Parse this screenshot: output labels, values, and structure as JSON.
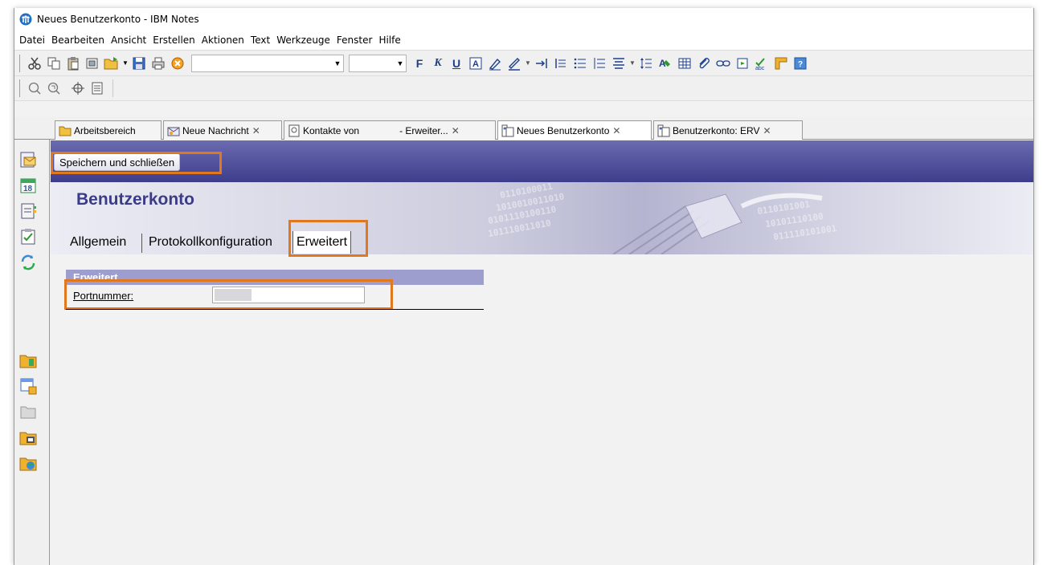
{
  "window": {
    "title": "Neues Benutzerkonto - IBM Notes"
  },
  "menu": [
    "Datei",
    "Bearbeiten",
    "Ansicht",
    "Erstellen",
    "Aktionen",
    "Text",
    "Werkzeuge",
    "Fenster",
    "Hilfe"
  ],
  "toolbar": {
    "icons": [
      "cut-icon",
      "copy-icon",
      "paste-icon",
      "paste-special-icon",
      "open-folder-icon",
      "save-icon",
      "print-icon",
      "stop-icon"
    ],
    "format_buttons": [
      "F",
      "K",
      "U"
    ],
    "format_icons": [
      "text-color-icon",
      "highlighter-icon",
      "pen-color-icon",
      "indent-icon",
      "outdent-icon",
      "bullet-list-icon",
      "numbered-list-icon",
      "align-icon",
      "spacing-icon",
      "styles-icon",
      "table-icon",
      "attachment-icon",
      "link-icon",
      "insert-icon",
      "spellcheck-icon",
      "hotspot-icon",
      "properties-icon"
    ]
  },
  "toolbar2": {
    "icons": [
      "search-icon",
      "search-next-icon",
      "navigate-icon",
      "calendar-view-icon"
    ]
  },
  "tabs": [
    {
      "label": "Arbeitsbereich",
      "icon": "folder-icon",
      "closable": false
    },
    {
      "label": "Neue Nachricht",
      "icon": "mail-icon",
      "closable": true
    },
    {
      "label": "Kontakte von",
      "label_suffix": "- Erweiter...",
      "icon": "contacts-icon",
      "closable": true
    },
    {
      "label": "Neues Benutzerkonto",
      "icon": "document-icon",
      "closable": true,
      "active": true
    },
    {
      "label": "Benutzerkonto: ERV",
      "icon": "document-icon",
      "closable": true
    }
  ],
  "sidebar": [
    "mail-icon",
    "calendar-icon",
    "contacts-icon",
    "todo-icon",
    "sametime-icon",
    "bookmark-folder-icon",
    "database-icon",
    "folder-icon",
    "applications-icon",
    "web-icon"
  ],
  "calendar_day": "18",
  "action_bar": {
    "save_label": "Speichern und schließen"
  },
  "form": {
    "title": "Benutzerkonto",
    "tabs": [
      "Allgemein",
      "Protokollkonfiguration",
      "Erweitert"
    ],
    "active_tab": "Erweitert",
    "section": "Erweitert",
    "port_label": "Portnummer:",
    "port_value": ""
  },
  "colors": {
    "accent": "#e07820",
    "action_bar": "#4a4a98",
    "section_header": "#9e9ece",
    "title": "#3c3c86"
  }
}
